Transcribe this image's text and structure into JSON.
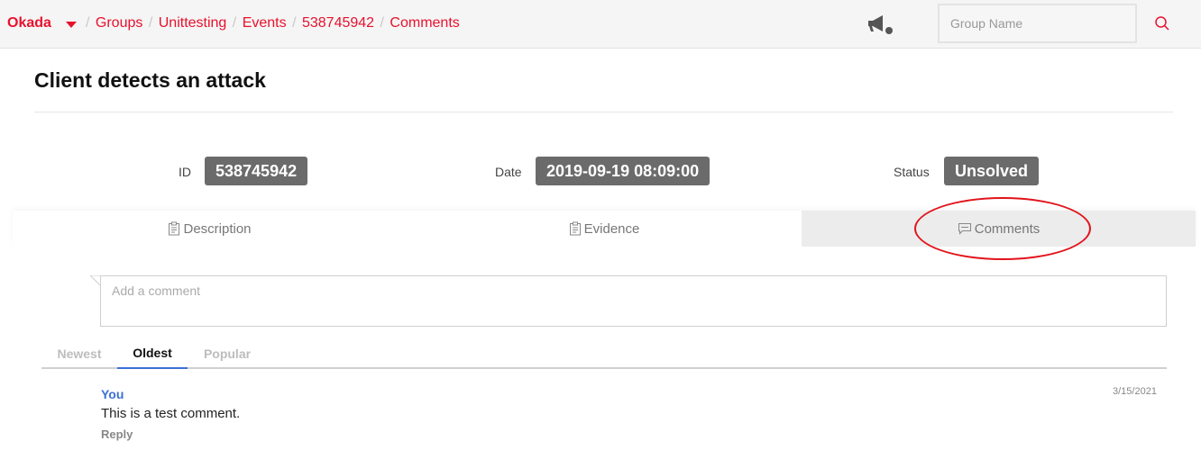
{
  "header": {
    "brand": "Okada",
    "breadcrumbs": [
      {
        "label": "Groups"
      },
      {
        "label": "Unittesting"
      },
      {
        "label": "Events"
      },
      {
        "label": "538745942"
      },
      {
        "label": "Comments"
      }
    ],
    "separator": "/",
    "search_placeholder": "Group Name",
    "icons": {
      "notifications": "megaphone-icon",
      "search": "search-icon",
      "brand_menu": "caret-down-icon"
    },
    "accent_color": "#e8112d"
  },
  "page": {
    "title": "Client detects an attack"
  },
  "meta": {
    "id_label": "ID",
    "id_value": "538745942",
    "date_label": "Date",
    "date_value": "2019-09-19 08:09:00",
    "status_label": "Status",
    "status_value": "Unsolved"
  },
  "tabs": [
    {
      "label": "Description",
      "icon": "clipboard-icon",
      "active": false
    },
    {
      "label": "Evidence",
      "icon": "clipboard-icon",
      "active": false
    },
    {
      "label": "Comments",
      "icon": "comment-icon",
      "active": true
    }
  ],
  "comments_section": {
    "input_placeholder": "Add a comment",
    "sort_tabs": [
      {
        "label": "Newest",
        "active": false
      },
      {
        "label": "Oldest",
        "active": true
      },
      {
        "label": "Popular",
        "active": false
      }
    ],
    "comments": [
      {
        "author": "You",
        "text": "This is a test comment.",
        "date": "3/15/2021",
        "reply_label": "Reply"
      }
    ]
  }
}
